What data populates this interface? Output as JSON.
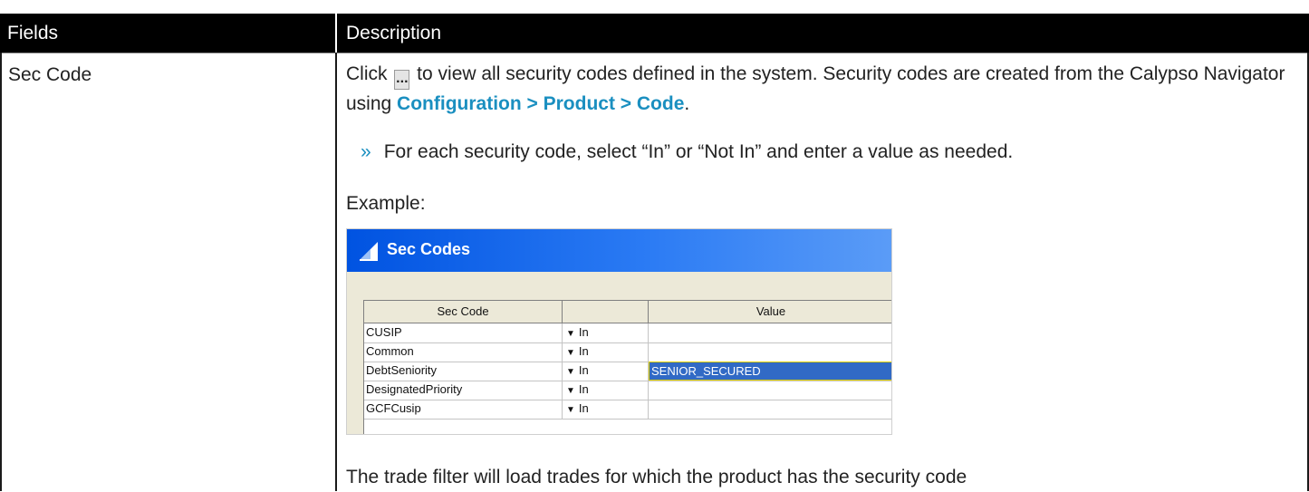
{
  "table": {
    "header": {
      "fields": "Fields",
      "description": "Description"
    },
    "row": {
      "field_name": "Sec Code",
      "intro_before_button": "Click ",
      "button_label": "...",
      "intro_after_button": " to view all security codes defined in the system. Security codes are created from the Calypso Navigator using ",
      "menu_path": "Configuration > Product > Code",
      "intro_end": ".",
      "bullet_marker": "»",
      "bullet_text": "For each security code, select “In” or “Not In” and enter a value as needed.",
      "example_label": "Example:",
      "trailing_text": "The trade filter will load trades for which the product has the security code"
    }
  },
  "screenshot": {
    "window_title": "Sec Codes",
    "columns": [
      "Sec Code",
      "",
      "Value"
    ],
    "rows": [
      {
        "code": "CUSIP",
        "op": "In",
        "value": ""
      },
      {
        "code": "Common",
        "op": "In",
        "value": ""
      },
      {
        "code": "DebtSeniority",
        "op": "In",
        "value": "SENIOR_SECURED",
        "selected": true
      },
      {
        "code": "DesignatedPriority",
        "op": "In",
        "value": ""
      },
      {
        "code": "GCFCusip",
        "op": "In",
        "value": ""
      }
    ]
  },
  "colors": {
    "header_bg": "#000000",
    "link_blue": "#1a8fc0",
    "title_bar": "#0053e1",
    "selection": "#316ac5"
  },
  "icons": {
    "window": "app-window-icon",
    "dropdown": "dropdown-arrow-icon"
  }
}
